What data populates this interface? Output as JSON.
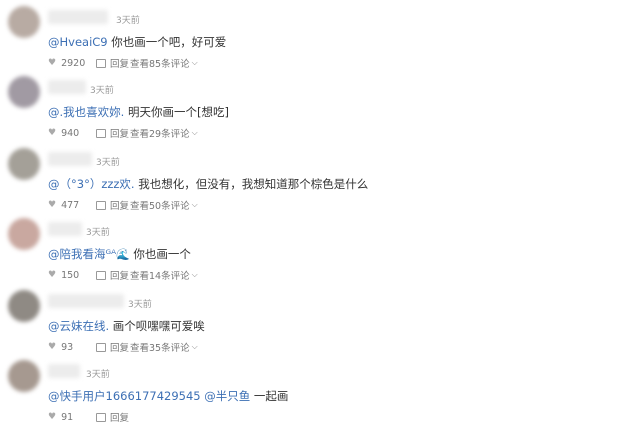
{
  "comments": [
    {
      "time": "3天前",
      "mention": "@HveaiC9",
      "text": " 你也画一个吧，好可爱",
      "likes": "2920",
      "reply_label": "回复",
      "view_replies": "查看85条评论",
      "avatar_color": "#b8aba3"
    },
    {
      "time": "3天前",
      "mention": "@.我也喜欢妳.",
      "text": " 明天你画一个[想吃]",
      "likes": "940",
      "reply_label": "回复",
      "view_replies": "查看29条评论",
      "avatar_color": "#a19aa3"
    },
    {
      "time": "3天前",
      "mention": "@（°3°）zzz欢.",
      "text": " 我也想化，但没有，我想知道那个棕色是什么",
      "likes": "477",
      "reply_label": "回复",
      "view_replies": "查看50条评论",
      "avatar_color": "#a4a098"
    },
    {
      "time": "3天前",
      "mention": "@陪我看海ᴳᴬ",
      "emoji": "🌊",
      "text": " 你也画一个",
      "likes": "150",
      "reply_label": "回复",
      "view_replies": "查看14条评论",
      "avatar_color": "#c9a8a0"
    },
    {
      "time": "3天前",
      "mention": "@云妹在线.",
      "text": " 画个呗嘿嘿可爱唉",
      "likes": "93",
      "reply_label": "回复",
      "view_replies": "查看35条评论",
      "avatar_color": "#8f8a84"
    },
    {
      "time": "3天前",
      "mention": "@快手用户1666177429545 @半只鱼",
      "text": " 一起画",
      "likes": "91",
      "reply_label": "回复",
      "view_replies": "",
      "avatar_color": "#a69990"
    }
  ]
}
